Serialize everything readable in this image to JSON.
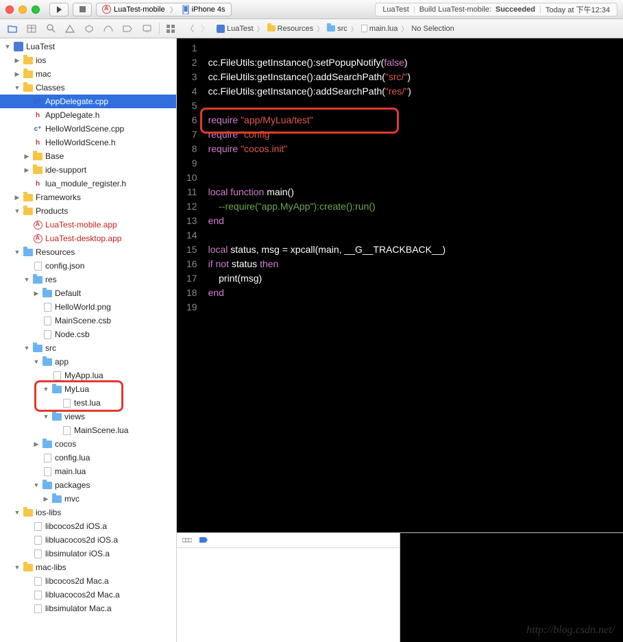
{
  "titlebar": {
    "scheme": {
      "target": "LuaTest-mobile",
      "device": "iPhone 4s"
    },
    "status": {
      "project": "LuaTest",
      "action": "Build LuaTest-mobile:",
      "result": "Succeeded",
      "time": "Today at 下午12:34"
    }
  },
  "breadcrumb": [
    "LuaTest",
    "Resources",
    "src",
    "main.lua",
    "No Selection"
  ],
  "tree": [
    {
      "d": 0,
      "exp": "open",
      "ico": "xcproj",
      "label": "LuaTest"
    },
    {
      "d": 1,
      "exp": "closed",
      "ico": "folder",
      "label": "ios"
    },
    {
      "d": 1,
      "exp": "closed",
      "ico": "folder",
      "label": "mac"
    },
    {
      "d": 1,
      "exp": "open",
      "ico": "folder",
      "label": "Classes"
    },
    {
      "d": 2,
      "exp": "",
      "ico": "cfile",
      "label": "AppDelegate.cpp",
      "sel": true
    },
    {
      "d": 2,
      "exp": "",
      "ico": "hfile",
      "label": "AppDelegate.h"
    },
    {
      "d": 2,
      "exp": "",
      "ico": "cfile",
      "label": "HelloWorldScene.cpp"
    },
    {
      "d": 2,
      "exp": "",
      "ico": "hfile",
      "label": "HelloWorldScene.h"
    },
    {
      "d": 2,
      "exp": "closed",
      "ico": "folder",
      "label": "Base"
    },
    {
      "d": 2,
      "exp": "closed",
      "ico": "folder",
      "label": "ide-support"
    },
    {
      "d": 2,
      "exp": "",
      "ico": "hfile",
      "label": "lua_module_register.h"
    },
    {
      "d": 1,
      "exp": "closed",
      "ico": "folder",
      "label": "Frameworks"
    },
    {
      "d": 1,
      "exp": "open",
      "ico": "folder",
      "label": "Products"
    },
    {
      "d": 2,
      "exp": "",
      "ico": "app",
      "label": "LuaTest-mobile.app",
      "red": true
    },
    {
      "d": 2,
      "exp": "",
      "ico": "app",
      "label": "LuaTest-desktop.app",
      "red": true
    },
    {
      "d": 1,
      "exp": "open",
      "ico": "bluefolder",
      "label": "Resources"
    },
    {
      "d": 2,
      "exp": "",
      "ico": "file",
      "label": "config.json"
    },
    {
      "d": 2,
      "exp": "open",
      "ico": "bluefolder",
      "label": "res"
    },
    {
      "d": 3,
      "exp": "closed",
      "ico": "bluefolder",
      "label": "Default"
    },
    {
      "d": 3,
      "exp": "",
      "ico": "file",
      "label": "HelloWorld.png"
    },
    {
      "d": 3,
      "exp": "",
      "ico": "file",
      "label": "MainScene.csb"
    },
    {
      "d": 3,
      "exp": "",
      "ico": "file",
      "label": "Node.csb"
    },
    {
      "d": 2,
      "exp": "open",
      "ico": "bluefolder",
      "label": "src"
    },
    {
      "d": 3,
      "exp": "open",
      "ico": "bluefolder",
      "label": "app"
    },
    {
      "d": 4,
      "exp": "",
      "ico": "file",
      "label": "MyApp.lua"
    },
    {
      "d": 4,
      "exp": "open",
      "ico": "bluefolder",
      "label": "MyLua",
      "annot": "folder"
    },
    {
      "d": 5,
      "exp": "",
      "ico": "file",
      "label": "test.lua",
      "annot": "folder"
    },
    {
      "d": 4,
      "exp": "open",
      "ico": "bluefolder",
      "label": "views"
    },
    {
      "d": 5,
      "exp": "",
      "ico": "file",
      "label": "MainScene.lua"
    },
    {
      "d": 3,
      "exp": "closed",
      "ico": "bluefolder",
      "label": "cocos"
    },
    {
      "d": 3,
      "exp": "",
      "ico": "file",
      "label": "config.lua"
    },
    {
      "d": 3,
      "exp": "",
      "ico": "file",
      "label": "main.lua"
    },
    {
      "d": 3,
      "exp": "open",
      "ico": "bluefolder",
      "label": "packages"
    },
    {
      "d": 4,
      "exp": "closed",
      "ico": "bluefolder",
      "label": "mvc"
    },
    {
      "d": 1,
      "exp": "open",
      "ico": "folder",
      "label": "ios-libs"
    },
    {
      "d": 2,
      "exp": "",
      "ico": "file",
      "label": "libcocos2d iOS.a"
    },
    {
      "d": 2,
      "exp": "",
      "ico": "file",
      "label": "libluacocos2d iOS.a"
    },
    {
      "d": 2,
      "exp": "",
      "ico": "file",
      "label": "libsimulator iOS.a"
    },
    {
      "d": 1,
      "exp": "open",
      "ico": "folder",
      "label": "mac-libs"
    },
    {
      "d": 2,
      "exp": "",
      "ico": "file",
      "label": "libcocos2d Mac.a"
    },
    {
      "d": 2,
      "exp": "",
      "ico": "file",
      "label": "libluacocos2d Mac.a"
    },
    {
      "d": 2,
      "exp": "",
      "ico": "file",
      "label": "libsimulator Mac.a"
    }
  ],
  "code_lines": [
    {
      "n": 1,
      "html": ""
    },
    {
      "n": 2,
      "html": "cc.FileUtils:getInstance():setPopupNotify(<span class='kw'>false</span>)"
    },
    {
      "n": 3,
      "html": "cc.FileUtils:getInstance():addSearchPath(<span class='str'>\"src/\"</span>)"
    },
    {
      "n": 4,
      "html": "cc.FileUtils:getInstance():addSearchPath(<span class='str'>\"res/\"</span>)"
    },
    {
      "n": 5,
      "html": ""
    },
    {
      "n": 6,
      "html": "<span class='kw'>require</span> <span class='str'>\"app/MyLua/test\"</span>",
      "annot": true
    },
    {
      "n": 7,
      "html": "<span class='kw'>require</span> <span class='str'>\"config\"</span>"
    },
    {
      "n": 8,
      "html": "<span class='kw'>require</span> <span class='str'>\"cocos.init\"</span>"
    },
    {
      "n": 9,
      "html": ""
    },
    {
      "n": 10,
      "html": ""
    },
    {
      "n": 11,
      "html": "<span class='kw'>local</span> <span class='kw'>function</span> main()"
    },
    {
      "n": 12,
      "html": "    <span class='cm'>--require(\"app.MyApp\"):create():run()</span>"
    },
    {
      "n": 13,
      "html": "<span class='kw'>end</span>"
    },
    {
      "n": 14,
      "html": ""
    },
    {
      "n": 15,
      "html": "<span class='kw'>local</span> status, msg = xpcall(main, __G__TRACKBACK__)"
    },
    {
      "n": 16,
      "html": "<span class='kw'>if</span> <span class='kw'>not</span> status <span class='kw'>then</span>"
    },
    {
      "n": 17,
      "html": "    print(msg)"
    },
    {
      "n": 18,
      "html": "<span class='kw'>end</span>"
    },
    {
      "n": 19,
      "html": ""
    }
  ],
  "watermark": "http://blog.csdn.net/"
}
